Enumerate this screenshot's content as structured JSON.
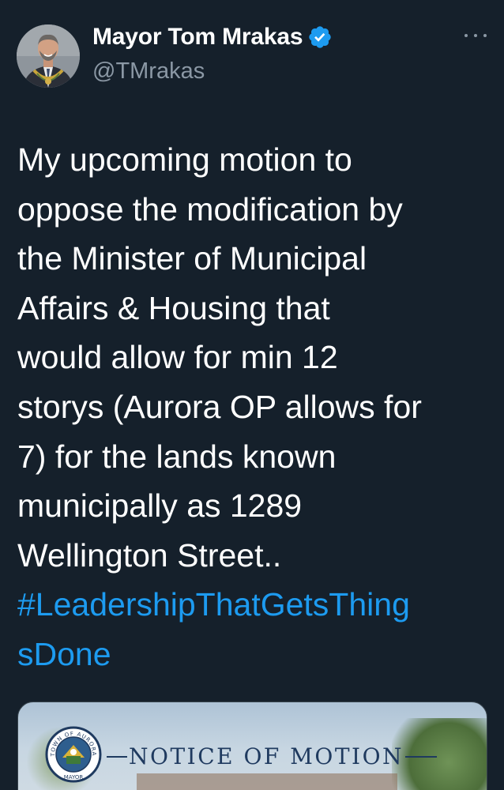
{
  "author": {
    "display_name": "Mayor Tom Mrakas",
    "handle": "@TMrakas",
    "verified": true,
    "avatar": "profile-photo"
  },
  "menu": {
    "icon": "more-horizontal-icon"
  },
  "tweet": {
    "lines": [
      "My upcoming motion to",
      "oppose the modification by",
      "the Minister of Municipal",
      "Affairs & Housing that",
      "would allow for min 12",
      "storys (Aurora OP allows for",
      "7) for the lands known",
      "municipally as 1289",
      "Wellington Street.."
    ],
    "hashtag_lines": [
      "#LeadershipThatGetsThing",
      "sDone"
    ]
  },
  "media": {
    "title": "NOTICE OF MOTION",
    "seal_text_top": "TOWN OF AURORA",
    "seal_text_bottom": "MAYOR"
  },
  "colors": {
    "background": "#15202b",
    "text": "#ffffff",
    "secondary_text": "#8b98a5",
    "link": "#1d9bf0",
    "verified_badge": "#1d9bf0"
  }
}
